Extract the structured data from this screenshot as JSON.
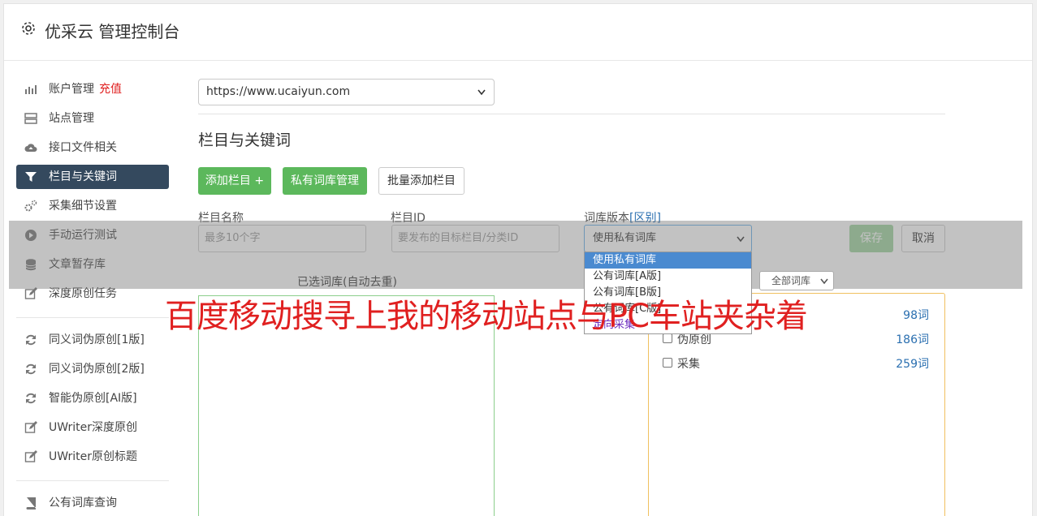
{
  "app": {
    "title": "优采云 管理控制台"
  },
  "sidebar": {
    "items": [
      {
        "label": "账户管理",
        "extra": "充值"
      },
      {
        "label": "站点管理"
      },
      {
        "label": "接口文件相关"
      },
      {
        "label": "栏目与关键词"
      },
      {
        "label": "采集细节设置"
      },
      {
        "label": "手动运行测试"
      },
      {
        "label": "文章暂存库"
      },
      {
        "label": "深度原创任务"
      },
      {
        "label": "同义词伪原创[1版]"
      },
      {
        "label": "同义词伪原创[2版]"
      },
      {
        "label": "智能伪原创[AI版]"
      },
      {
        "label": "UWriter深度原创"
      },
      {
        "label": "UWriter原创标题"
      },
      {
        "label": "公有词库查询"
      }
    ]
  },
  "main": {
    "site_select": "https://www.ucaiyun.com",
    "section_title": "栏目与关键词",
    "buttons": {
      "add_column": "添加栏目 +",
      "private_lib": "私有词库管理",
      "batch_add": "批量添加栏目",
      "save": "保存",
      "cancel": "取消"
    },
    "form": {
      "col_name_label": "栏目名称",
      "col_name_placeholder": "最多10个字",
      "col_id_label": "栏目ID",
      "col_id_placeholder": "要发布的目标栏目/分类ID",
      "lib_version_label": "词库版本",
      "lib_version_diff": "[区别]",
      "lib_version_value": "使用私有词库"
    },
    "dropdown_options": [
      "使用私有词库",
      "公有词库[A版]",
      "公有词库[B版]",
      "公有词库[C版]",
      "定向采集"
    ],
    "selected_lib_label": "已选词库(自动去重)",
    "all_lib_select": "全部词库",
    "lib_list": [
      {
        "name": "",
        "count": "98词"
      },
      {
        "name": "伪原创",
        "count": "186词"
      },
      {
        "name": "采集",
        "count": "259词"
      }
    ]
  },
  "watermark": "百度移动搜寻上我的移动站点与PC车站夹杂着",
  "colors": {
    "accent_green": "#5cb85c",
    "active_nav": "#34495e",
    "watermark_red": "#e02020"
  }
}
